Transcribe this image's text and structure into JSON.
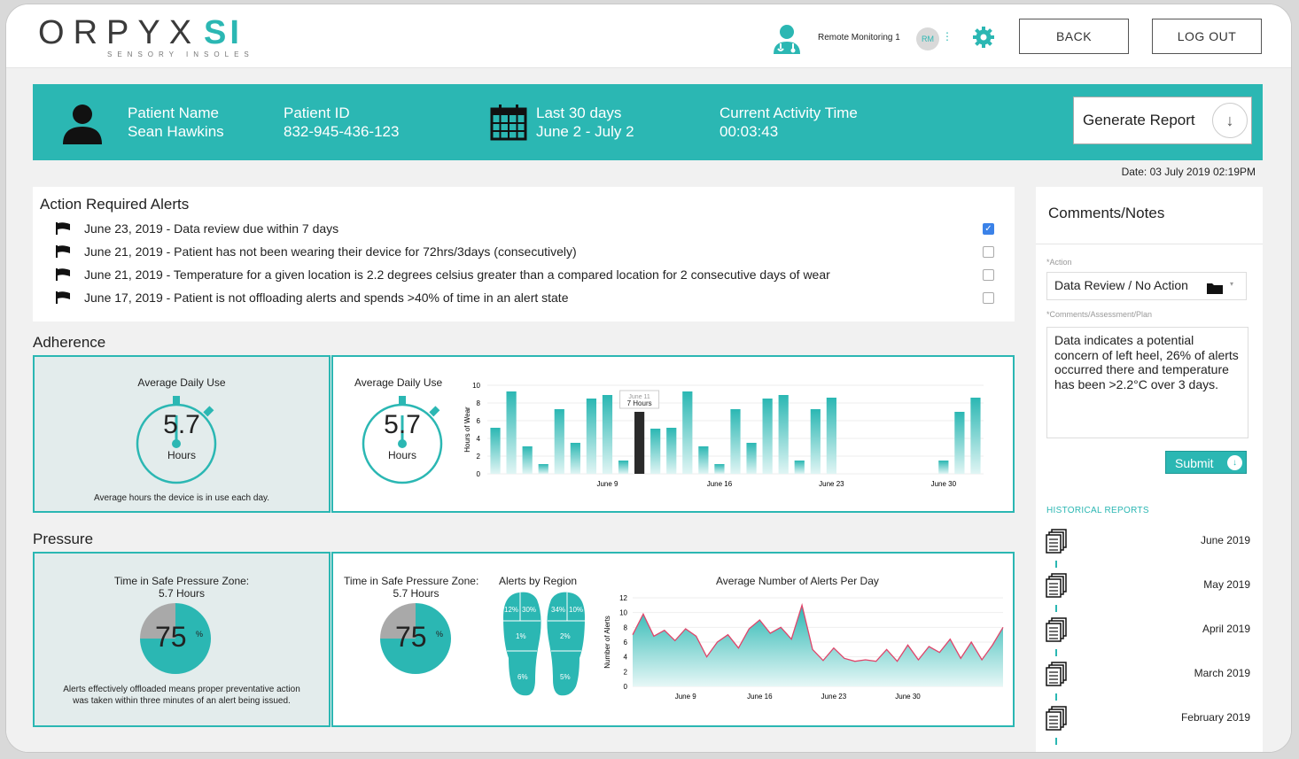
{
  "header": {
    "logo_main": "RPYX",
    "logo_o": "O",
    "logo_si": "SI",
    "logo_sub": "SENSORY INSOLES",
    "user_label": "Remote Monitoring 1",
    "user_initials": "RM",
    "back_label": "BACK",
    "logout_label": "LOG OUT"
  },
  "patient": {
    "name_label": "Patient Name",
    "name": "Sean Hawkins",
    "id_label": "Patient ID",
    "id": "832-945-436-123",
    "range_label": "Last 30 days",
    "range": "June 2 - July 2",
    "activity_label": "Current Activity Time",
    "activity": "00:03:43",
    "report_label": "Generate Report"
  },
  "date_stamp": "Date: 03 July 2019 02:19PM",
  "alerts": {
    "title": "Action Required Alerts",
    "items": [
      {
        "text": "June 23, 2019 - Data review due within 7 days",
        "checked": true
      },
      {
        "text": "June 21, 2019 - Patient has not been wearing their device for 72hrs/3days (consecutively)",
        "checked": false
      },
      {
        "text": "June 21, 2019 - Temperature for a given location is 2.2 degrees celsius greater than a compared location for 2 consecutive days of wear",
        "checked": false
      },
      {
        "text": "June 17, 2019 - Patient is not offloading alerts and spends >40% of time in an alert state",
        "checked": false
      }
    ]
  },
  "adherence": {
    "section_title": "Adherence",
    "left_title": "Average Daily Use",
    "value": "5.7",
    "value_unit": "Hours",
    "left_note": "Average hours the device is in use each day.",
    "right_title": "Average Daily Use",
    "tooltip_date": "June 11",
    "tooltip_value": "7 Hours"
  },
  "pressure": {
    "section_title": "Pressure",
    "left_title": "Time in Safe Pressure Zone:",
    "left_subtitle": "5.7 Hours",
    "percent": "75",
    "percent_sign": "%",
    "left_note_1": "Alerts effectively offloaded means proper preventative action",
    "left_note_2": "was taken within three minutes of an alert being issued.",
    "right_title": "Time in Safe Pressure Zone:",
    "right_subtitle": "5.7 Hours",
    "regions_title": "Alerts by Region",
    "regions": {
      "left_top_a": "12%",
      "left_top_b": "30%",
      "left_mid": "1%",
      "left_heel": "6%",
      "right_top_a": "34%",
      "right_top_b": "10%",
      "right_mid": "2%",
      "right_heel": "5%"
    },
    "alerts_chart_title": "Average Number of Alerts Per Day"
  },
  "chart_data": [
    {
      "type": "bar",
      "title": "Average Daily Use",
      "ylabel": "Hours of Wear",
      "ylim": [
        0,
        10
      ],
      "yticks": [
        0,
        2,
        4,
        6,
        8,
        10
      ],
      "xtick_labels": [
        {
          "index": 7,
          "label": "June 9"
        },
        {
          "index": 14,
          "label": "June 16"
        },
        {
          "index": 21,
          "label": "June 23"
        },
        {
          "index": 28,
          "label": "June 30"
        }
      ],
      "highlight_index": 9,
      "values": [
        5.2,
        9.3,
        3.1,
        1.1,
        7.3,
        3.5,
        8.5,
        8.9,
        1.5,
        7.0,
        5.1,
        5.2,
        9.3,
        3.1,
        1.1,
        7.3,
        3.5,
        8.5,
        8.9,
        1.5,
        7.3,
        8.6,
        0,
        0,
        0,
        0,
        0,
        0,
        1.5,
        7.0,
        8.6
      ]
    },
    {
      "type": "pie",
      "title": "Time in Safe Pressure Zone:",
      "values": [
        75,
        25
      ]
    },
    {
      "type": "area",
      "title": "Average Number of Alerts Per Day",
      "ylabel": "Number of Alerts",
      "ylim": [
        0,
        12
      ],
      "yticks": [
        0,
        2,
        4,
        6,
        8,
        10,
        12
      ],
      "xtick_labels": [
        {
          "index": 5,
          "label": "June 9"
        },
        {
          "index": 12,
          "label": "June 16"
        },
        {
          "index": 19,
          "label": "June 23"
        },
        {
          "index": 26,
          "label": "June 30"
        }
      ],
      "values": [
        7,
        9.8,
        6.8,
        7.6,
        6.2,
        7.8,
        6.8,
        4,
        6,
        7,
        5.2,
        7.8,
        9,
        7.2,
        8,
        6.4,
        11,
        5,
        3.5,
        5.2,
        3.8,
        3.4,
        3.6,
        3.4,
        5,
        3.4,
        5.6,
        3.6,
        5.4,
        4.6,
        6.4,
        3.8,
        6,
        3.6,
        5.6,
        8
      ]
    }
  ],
  "comments": {
    "title": "Comments/Notes",
    "action_label": "*Action",
    "action_value": "Data Review / No Action",
    "comments_label": "*Comments/Assessment/Plan",
    "comments_value": "Data indicates a potential concern of left heel, 26% of alerts occurred there and temperature has been >2.2°C over 3 days.",
    "submit_label": "Submit"
  },
  "historical": {
    "title": "HISTORICAL REPORTS",
    "items": [
      "June 2019",
      "May 2019",
      "April 2019",
      "March 2019",
      "February 2019"
    ]
  },
  "colors": {
    "accent": "#2bb7b3",
    "highlight_bar": "#2a2a2a",
    "alert_line": "#e0456a",
    "checkbox": "#3b82e8"
  }
}
